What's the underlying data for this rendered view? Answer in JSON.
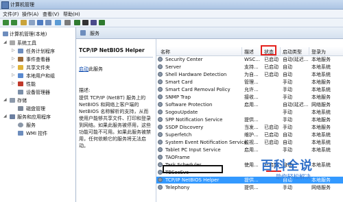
{
  "window": {
    "title": "计算机管理"
  },
  "menu": [
    "文件(F)",
    "操作(A)",
    "查看(V)",
    "帮助(H)"
  ],
  "tree": [
    {
      "label": "计算机管理(本地)",
      "icon": "computer-icon"
    },
    {
      "label": "系统工具",
      "icon": "tools-icon"
    },
    {
      "label": "任务计划程序",
      "icon": "clock-icon"
    },
    {
      "label": "事件查看器",
      "icon": "event-icon"
    },
    {
      "label": "共享文件夹",
      "icon": "folder-icon"
    },
    {
      "label": "本地用户和组",
      "icon": "users-icon"
    },
    {
      "label": "性能",
      "icon": "performance-icon"
    },
    {
      "label": "设备管理器",
      "icon": "device-icon"
    },
    {
      "label": "存储",
      "icon": "storage-icon"
    },
    {
      "label": "磁盘管理",
      "icon": "disk-icon"
    },
    {
      "label": "服务和应用程序",
      "icon": "apps-icon"
    },
    {
      "label": "服务",
      "icon": "services-icon"
    },
    {
      "label": "WMI 控件",
      "icon": "wmi-icon"
    }
  ],
  "breadcrumb": "服务",
  "detail": {
    "title": "TCP/IP NetBIOS Helper",
    "link_text": "启动",
    "link_suffix": "此服务",
    "desc_label": "描述:",
    "desc": "提供 TCP/IP (NetBT) 服务上的 NetBIOS 和网络上客户端的 NetBIOS 名称解析的支持，从而使用户能够共享文件、打印和登录到网络。如果此服务被停用，这些功能可能不可用。如果此服务被禁用，任何依赖它的服务将无法启动。"
  },
  "columns": [
    "名称",
    "描述",
    "状态",
    "启动类型",
    "登录为"
  ],
  "rows": [
    {
      "name": "Security Center",
      "desc": "WSC...",
      "status": "已启动",
      "startup": "自动(延迟...",
      "logon": "本地服务"
    },
    {
      "name": "Server",
      "desc": "支持...",
      "status": "已启动",
      "startup": "自动",
      "logon": "本地系统"
    },
    {
      "name": "Shell Hardware Detection",
      "desc": "为自...",
      "status": "已启动",
      "startup": "自动",
      "logon": "本地系统"
    },
    {
      "name": "Smart Card",
      "desc": "管理...",
      "status": "",
      "startup": "手动",
      "logon": "本地服务"
    },
    {
      "name": "Smart Card Removal Policy",
      "desc": "允许...",
      "status": "",
      "startup": "手动",
      "logon": "本地系统"
    },
    {
      "name": "SNMP Trap",
      "desc": "接收...",
      "status": "",
      "startup": "手动",
      "logon": "本地服务"
    },
    {
      "name": "Software Protection",
      "desc": "启用...",
      "status": "",
      "startup": "自动(延迟...",
      "logon": "网络服务"
    },
    {
      "name": "SogouUpdate",
      "desc": "",
      "status": "",
      "startup": "手动",
      "logon": "本地系统"
    },
    {
      "name": "SPP Notification Service",
      "desc": "提供...",
      "status": "",
      "startup": "手动",
      "logon": "本地服务"
    },
    {
      "name": "SSDP Discovery",
      "desc": "当发...",
      "status": "已启动",
      "startup": "手动",
      "logon": "本地服务"
    },
    {
      "name": "Superfetch",
      "desc": "维护...",
      "status": "已启动",
      "startup": "自动",
      "logon": "本地系统"
    },
    {
      "name": "System Event Notification Service",
      "desc": "监视...",
      "status": "已启动",
      "startup": "自动",
      "logon": "本地系统"
    },
    {
      "name": "Tablet PC Input Service",
      "desc": "启用...",
      "status": "",
      "startup": "手动",
      "logon": "本地系统"
    },
    {
      "name": "TAOFrame",
      "desc": "",
      "status": "",
      "startup": "",
      "logon": ""
    },
    {
      "name": "Task Scheduler",
      "desc": "使用...",
      "status": "已启动",
      "startup": "自动",
      "logon": "本地系统"
    },
    {
      "name": "TBSecSvc",
      "desc": "",
      "status": "",
      "startup": "",
      "logon": ""
    },
    {
      "name": "TCP/IP NetBIOS Helper",
      "desc": "提供...",
      "status": "",
      "startup": "自动",
      "logon": "本地服务"
    },
    {
      "name": "Telephony",
      "desc": "提供...",
      "status": "",
      "startup": "手动",
      "logon": "网络服务"
    }
  ],
  "watermark": {
    "big": "百科全说",
    "small": "助你轻松解决"
  }
}
